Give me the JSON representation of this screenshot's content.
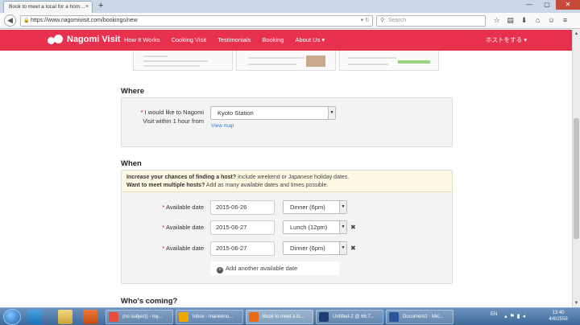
{
  "browser": {
    "tab_title": "Book to meet a local for a hom…",
    "tab_close": "×",
    "new_tab": "+",
    "url": "https://www.nagomivisit.com/bookings/new",
    "search_placeholder": "Search",
    "window_buttons": {
      "minimize": "—",
      "maximize": "▢",
      "close": "✕"
    }
  },
  "site": {
    "logo": "Nagomi Visit",
    "menu": [
      "How It Works",
      "Cooking Visit",
      "Testimonials",
      "Booking",
      "About Us ▾"
    ],
    "host_link": "ホストをする ▾"
  },
  "where": {
    "title": "Where",
    "label": "I would like to Nagomi Visit within 1 hour from",
    "station": "Kyoto Station",
    "view_map": "View map"
  },
  "when": {
    "title": "When",
    "notice_bold_1": "Increase your chances of finding a host?",
    "notice_text_1": " Include weekend or Japanese holiday dates.",
    "notice_bold_2": "Want to meet multiple hosts?",
    "notice_text_2": " Add as many available dates and times possible.",
    "rows": [
      {
        "label": "Available date",
        "date": "2015-06-26",
        "meal": "Dinner (6pm)",
        "removable": false
      },
      {
        "label": "Available date",
        "date": "2015-06-27",
        "meal": "Lunch (12pm)",
        "removable": true
      },
      {
        "label": "Available date",
        "date": "2015-06-27",
        "meal": "Dinner (6pm)",
        "removable": true
      }
    ],
    "add_button": "Add another available date"
  },
  "whos_coming": {
    "title": "Who's coming?"
  },
  "taskbar": {
    "tasks": [
      {
        "label": "(no subject) - my...",
        "color": "#e74c3c"
      },
      {
        "label": "Inbox - maneeno...",
        "color": "#f0a500"
      },
      {
        "label": "Book to meet a lo...",
        "color": "#e86a1a"
      },
      {
        "label": "Untitled-2 @ 66.7...",
        "color": "#1b3f74"
      },
      {
        "label": "Document1 - Mic...",
        "color": "#2b579a"
      }
    ],
    "lang": "EN",
    "time": "13:40",
    "date": "4/6/2558"
  }
}
